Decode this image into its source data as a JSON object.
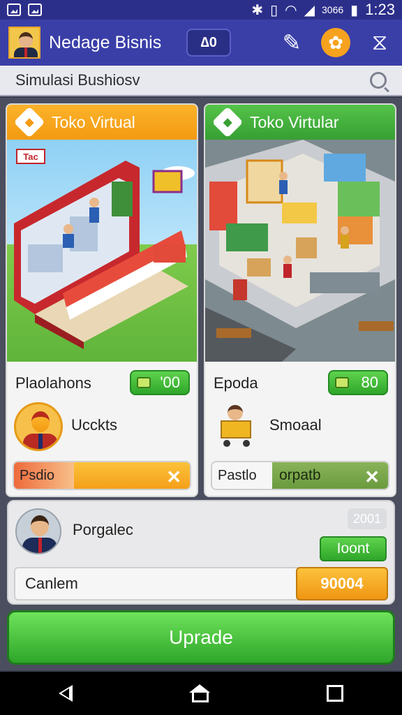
{
  "status": {
    "time": "1:23",
    "battery_text": "3066"
  },
  "appbar": {
    "title": "Nedage Bisnis",
    "coins": "∆0"
  },
  "subheader": {
    "title": "Simulasi Bushiosv"
  },
  "cards": [
    {
      "header": "Toko Virtual",
      "name": "Plaolahons",
      "price": "'00",
      "role": "Ucckts",
      "action_label": "Psdio",
      "action_value": "",
      "accent": "#f39a12"
    },
    {
      "header": "Toko Virtular",
      "name": "Epoda",
      "price": "80",
      "role": "Smoaal",
      "action_label": "Pastlo",
      "action_value": "orpatb",
      "accent": "#379f33"
    }
  ],
  "scene_sign": "Tac",
  "panel": {
    "name": "Porgalec",
    "version": "2001",
    "button": "Ioont",
    "row_label": "Canlem",
    "row_value": "90004"
  },
  "upgrade_label": "Uprade"
}
